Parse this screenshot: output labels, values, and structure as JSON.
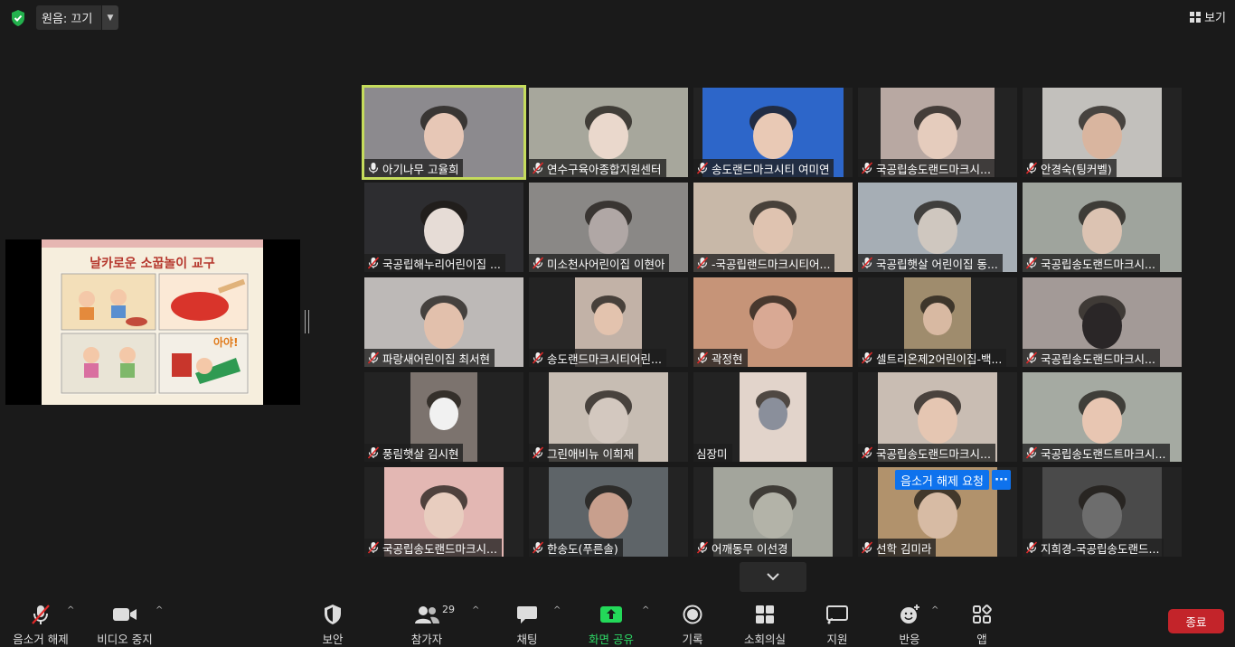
{
  "topbar": {
    "audio_label": "원음: 끄기",
    "view_label": "보기"
  },
  "share": {
    "slide_title": "날카로운 소꿉놀이 교구"
  },
  "tiles": [
    {
      "name": "아기나무 고율희",
      "mic": "on",
      "bg": "#8c8a8e",
      "w": 176,
      "skin": "#e7c7b6"
    },
    {
      "name": "연수구육아종합지원센터",
      "mic": "off",
      "bg": "#a7a79c",
      "w": 176,
      "skin": "#ead8cc"
    },
    {
      "name": "송도랜드마크시티 여미연",
      "mic": "off",
      "bg": "#2d66c9",
      "w": 156,
      "skin": "#e9c9b5"
    },
    {
      "name": "국공립송도랜드마크시...",
      "mic": "off",
      "bg": "#b8a8a2",
      "w": 126,
      "skin": "#e5ccbd"
    },
    {
      "name": "안경숙(팅커벨)",
      "mic": "off",
      "bg": "#c2c0bc",
      "w": 132,
      "skin": "#d9b59f"
    },
    {
      "name": "국공립해누리어린이집 ...",
      "mic": "off",
      "bg": "#2d2d30",
      "w": 176,
      "skin": "#e6dcd6"
    },
    {
      "name": "미소천사어린이집 이현아",
      "mic": "off",
      "bg": "#8a8886",
      "w": 176,
      "skin": "#b0a7a5"
    },
    {
      "name": "-국공립랜드마크시티어...",
      "mic": "off",
      "bg": "#c8b8a8",
      "w": 176,
      "skin": "#dfc3b0"
    },
    {
      "name": "국공립햇살 어린이집 동...",
      "mic": "off",
      "bg": "#a6aeb5",
      "w": 176,
      "skin": "#cfc7bf"
    },
    {
      "name": "국공립송도랜드마크시...",
      "mic": "off",
      "bg": "#9fa49d",
      "w": 176,
      "skin": "#dcc3b2"
    },
    {
      "name": "파랑새어린이집  최서현",
      "mic": "off",
      "bg": "#bdb9b7",
      "w": 176,
      "skin": "#e2c0ac"
    },
    {
      "name": "송도랜드마크시티어린...",
      "mic": "off",
      "bg": "#c2b2a7",
      "w": 74,
      "skin": "#e3c3ae"
    },
    {
      "name": "곽정현",
      "mic": "off",
      "bg": "#c69478",
      "w": 176,
      "skin": "#d9a994"
    },
    {
      "name": "셀트리온제2어린이집-백...",
      "mic": "off",
      "bg": "#9f8c6d",
      "w": 74,
      "skin": "#d8b9a2"
    },
    {
      "name": "국공립송도랜드마크시...",
      "mic": "off",
      "bg": "#a39a97",
      "w": 176,
      "skin": "#2a2627"
    },
    {
      "name": "풍림햇살 김시현",
      "mic": "off",
      "bg": "#7c736e",
      "w": 74,
      "skin": "#f1f1f1"
    },
    {
      "name": "그린애비뉴 이희재",
      "mic": "off",
      "bg": "#c7bdb3",
      "w": 132,
      "skin": "#d3c8bf"
    },
    {
      "name": "심장미",
      "mic": "none",
      "bg": "#e2d4cb",
      "w": 74,
      "skin": "#8a8f9b"
    },
    {
      "name": "국공립송도랜드마크시...",
      "mic": "off",
      "bg": "#c9bdb3",
      "w": 132,
      "skin": "#e5c6b2"
    },
    {
      "name": "국공립송도랜드트마크시...",
      "mic": "off",
      "bg": "#a5aaa2",
      "w": 176,
      "skin": "#e8c6b2"
    },
    {
      "name": "국공립송도랜드마크시...",
      "mic": "off",
      "bg": "#e3b7b3",
      "w": 132,
      "skin": "#e8cdbf"
    },
    {
      "name": "한송도(푸른솔)",
      "mic": "off",
      "bg": "#5e6468",
      "w": 132,
      "skin": "#c89f8d"
    },
    {
      "name": "어깨동무 이선경",
      "mic": "off",
      "bg": "#a3a59c",
      "w": 132,
      "skin": "#b3b3a8"
    },
    {
      "name": "선학 김미라",
      "mic": "off",
      "bg": "#b1926c",
      "w": 132,
      "skin": "#d7bba4"
    },
    {
      "name": "지희경-국공립송도랜드...",
      "mic": "off",
      "bg": "#4a4a4a",
      "w": 132,
      "skin": "#6d6d6d"
    }
  ],
  "unmute_request": {
    "label": "음소거 해제 요청",
    "more": "···"
  },
  "toolbar": {
    "unmute": "음소거 해제",
    "video": "비디오 중지",
    "security": "보안",
    "participants": "참가자",
    "participants_count": "29",
    "chat": "채팅",
    "share": "화면 공유",
    "record": "기록",
    "breakout": "소회의실",
    "support": "지원",
    "reactions": "반응",
    "apps": "앱",
    "end": "종료"
  }
}
